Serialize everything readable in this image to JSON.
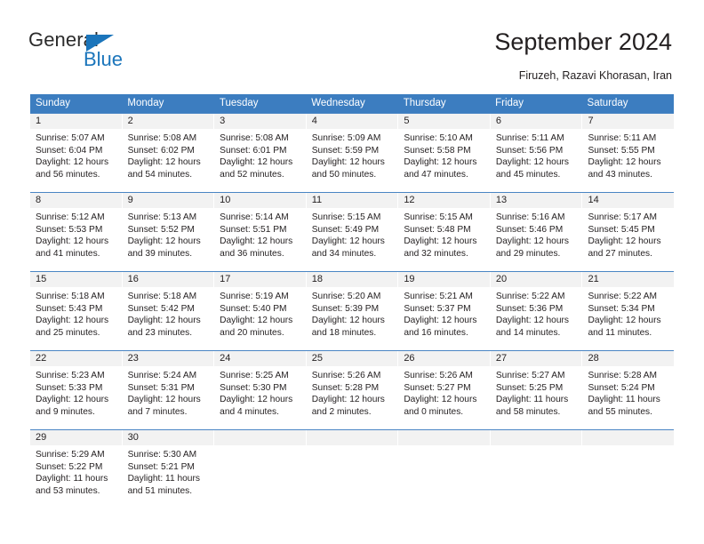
{
  "brand": {
    "name_part1": "General",
    "name_part2": "Blue",
    "triangle_icon": "triangle-icon",
    "accent_color": "#1b75bb"
  },
  "header": {
    "title": "September 2024",
    "subtitle": "Firuzeh, Razavi Khorasan, Iran"
  },
  "calendar": {
    "header_bg": "#3c7dc0",
    "daynum_bg": "#f2f2f2",
    "weekdays": [
      "Sunday",
      "Monday",
      "Tuesday",
      "Wednesday",
      "Thursday",
      "Friday",
      "Saturday"
    ],
    "weeks": [
      [
        {
          "day": "1",
          "sunrise": "Sunrise: 5:07 AM",
          "sunset": "Sunset: 6:04 PM",
          "daylight1": "Daylight: 12 hours",
          "daylight2": "and 56 minutes."
        },
        {
          "day": "2",
          "sunrise": "Sunrise: 5:08 AM",
          "sunset": "Sunset: 6:02 PM",
          "daylight1": "Daylight: 12 hours",
          "daylight2": "and 54 minutes."
        },
        {
          "day": "3",
          "sunrise": "Sunrise: 5:08 AM",
          "sunset": "Sunset: 6:01 PM",
          "daylight1": "Daylight: 12 hours",
          "daylight2": "and 52 minutes."
        },
        {
          "day": "4",
          "sunrise": "Sunrise: 5:09 AM",
          "sunset": "Sunset: 5:59 PM",
          "daylight1": "Daylight: 12 hours",
          "daylight2": "and 50 minutes."
        },
        {
          "day": "5",
          "sunrise": "Sunrise: 5:10 AM",
          "sunset": "Sunset: 5:58 PM",
          "daylight1": "Daylight: 12 hours",
          "daylight2": "and 47 minutes."
        },
        {
          "day": "6",
          "sunrise": "Sunrise: 5:11 AM",
          "sunset": "Sunset: 5:56 PM",
          "daylight1": "Daylight: 12 hours",
          "daylight2": "and 45 minutes."
        },
        {
          "day": "7",
          "sunrise": "Sunrise: 5:11 AM",
          "sunset": "Sunset: 5:55 PM",
          "daylight1": "Daylight: 12 hours",
          "daylight2": "and 43 minutes."
        }
      ],
      [
        {
          "day": "8",
          "sunrise": "Sunrise: 5:12 AM",
          "sunset": "Sunset: 5:53 PM",
          "daylight1": "Daylight: 12 hours",
          "daylight2": "and 41 minutes."
        },
        {
          "day": "9",
          "sunrise": "Sunrise: 5:13 AM",
          "sunset": "Sunset: 5:52 PM",
          "daylight1": "Daylight: 12 hours",
          "daylight2": "and 39 minutes."
        },
        {
          "day": "10",
          "sunrise": "Sunrise: 5:14 AM",
          "sunset": "Sunset: 5:51 PM",
          "daylight1": "Daylight: 12 hours",
          "daylight2": "and 36 minutes."
        },
        {
          "day": "11",
          "sunrise": "Sunrise: 5:15 AM",
          "sunset": "Sunset: 5:49 PM",
          "daylight1": "Daylight: 12 hours",
          "daylight2": "and 34 minutes."
        },
        {
          "day": "12",
          "sunrise": "Sunrise: 5:15 AM",
          "sunset": "Sunset: 5:48 PM",
          "daylight1": "Daylight: 12 hours",
          "daylight2": "and 32 minutes."
        },
        {
          "day": "13",
          "sunrise": "Sunrise: 5:16 AM",
          "sunset": "Sunset: 5:46 PM",
          "daylight1": "Daylight: 12 hours",
          "daylight2": "and 29 minutes."
        },
        {
          "day": "14",
          "sunrise": "Sunrise: 5:17 AM",
          "sunset": "Sunset: 5:45 PM",
          "daylight1": "Daylight: 12 hours",
          "daylight2": "and 27 minutes."
        }
      ],
      [
        {
          "day": "15",
          "sunrise": "Sunrise: 5:18 AM",
          "sunset": "Sunset: 5:43 PM",
          "daylight1": "Daylight: 12 hours",
          "daylight2": "and 25 minutes."
        },
        {
          "day": "16",
          "sunrise": "Sunrise: 5:18 AM",
          "sunset": "Sunset: 5:42 PM",
          "daylight1": "Daylight: 12 hours",
          "daylight2": "and 23 minutes."
        },
        {
          "day": "17",
          "sunrise": "Sunrise: 5:19 AM",
          "sunset": "Sunset: 5:40 PM",
          "daylight1": "Daylight: 12 hours",
          "daylight2": "and 20 minutes."
        },
        {
          "day": "18",
          "sunrise": "Sunrise: 5:20 AM",
          "sunset": "Sunset: 5:39 PM",
          "daylight1": "Daylight: 12 hours",
          "daylight2": "and 18 minutes."
        },
        {
          "day": "19",
          "sunrise": "Sunrise: 5:21 AM",
          "sunset": "Sunset: 5:37 PM",
          "daylight1": "Daylight: 12 hours",
          "daylight2": "and 16 minutes."
        },
        {
          "day": "20",
          "sunrise": "Sunrise: 5:22 AM",
          "sunset": "Sunset: 5:36 PM",
          "daylight1": "Daylight: 12 hours",
          "daylight2": "and 14 minutes."
        },
        {
          "day": "21",
          "sunrise": "Sunrise: 5:22 AM",
          "sunset": "Sunset: 5:34 PM",
          "daylight1": "Daylight: 12 hours",
          "daylight2": "and 11 minutes."
        }
      ],
      [
        {
          "day": "22",
          "sunrise": "Sunrise: 5:23 AM",
          "sunset": "Sunset: 5:33 PM",
          "daylight1": "Daylight: 12 hours",
          "daylight2": "and 9 minutes."
        },
        {
          "day": "23",
          "sunrise": "Sunrise: 5:24 AM",
          "sunset": "Sunset: 5:31 PM",
          "daylight1": "Daylight: 12 hours",
          "daylight2": "and 7 minutes."
        },
        {
          "day": "24",
          "sunrise": "Sunrise: 5:25 AM",
          "sunset": "Sunset: 5:30 PM",
          "daylight1": "Daylight: 12 hours",
          "daylight2": "and 4 minutes."
        },
        {
          "day": "25",
          "sunrise": "Sunrise: 5:26 AM",
          "sunset": "Sunset: 5:28 PM",
          "daylight1": "Daylight: 12 hours",
          "daylight2": "and 2 minutes."
        },
        {
          "day": "26",
          "sunrise": "Sunrise: 5:26 AM",
          "sunset": "Sunset: 5:27 PM",
          "daylight1": "Daylight: 12 hours",
          "daylight2": "and 0 minutes."
        },
        {
          "day": "27",
          "sunrise": "Sunrise: 5:27 AM",
          "sunset": "Sunset: 5:25 PM",
          "daylight1": "Daylight: 11 hours",
          "daylight2": "and 58 minutes."
        },
        {
          "day": "28",
          "sunrise": "Sunrise: 5:28 AM",
          "sunset": "Sunset: 5:24 PM",
          "daylight1": "Daylight: 11 hours",
          "daylight2": "and 55 minutes."
        }
      ],
      [
        {
          "day": "29",
          "sunrise": "Sunrise: 5:29 AM",
          "sunset": "Sunset: 5:22 PM",
          "daylight1": "Daylight: 11 hours",
          "daylight2": "and 53 minutes."
        },
        {
          "day": "30",
          "sunrise": "Sunrise: 5:30 AM",
          "sunset": "Sunset: 5:21 PM",
          "daylight1": "Daylight: 11 hours",
          "daylight2": "and 51 minutes."
        },
        {
          "day": "",
          "sunrise": "",
          "sunset": "",
          "daylight1": "",
          "daylight2": ""
        },
        {
          "day": "",
          "sunrise": "",
          "sunset": "",
          "daylight1": "",
          "daylight2": ""
        },
        {
          "day": "",
          "sunrise": "",
          "sunset": "",
          "daylight1": "",
          "daylight2": ""
        },
        {
          "day": "",
          "sunrise": "",
          "sunset": "",
          "daylight1": "",
          "daylight2": ""
        },
        {
          "day": "",
          "sunrise": "",
          "sunset": "",
          "daylight1": "",
          "daylight2": ""
        }
      ]
    ]
  }
}
